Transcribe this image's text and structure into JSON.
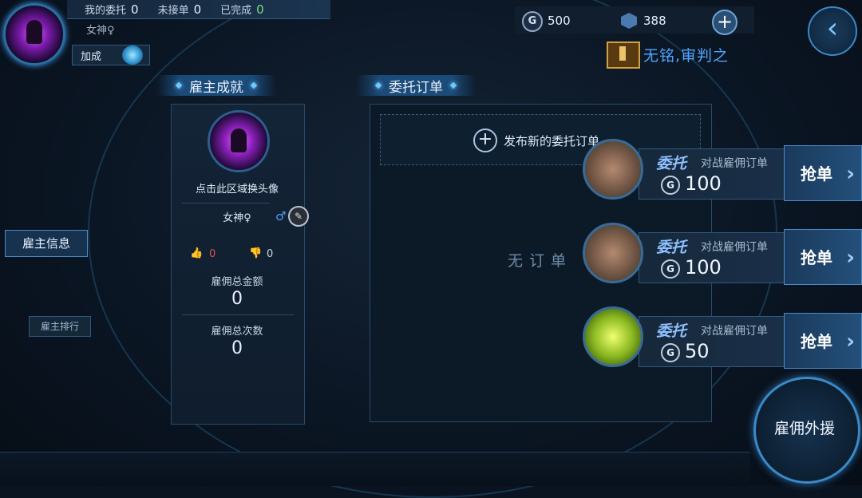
{
  "header": {
    "my_commission_label": "我的委托",
    "my_commission_count": "0",
    "unaccepted_label": "未接单",
    "unaccepted_count": "0",
    "completed_label": "已完成",
    "completed_count": "0",
    "player_name": "女神♀",
    "bonus_label": "加成"
  },
  "currency": {
    "coins": "500",
    "gems": "388",
    "coin_icon": "G"
  },
  "title_banner": "无铭,审判之",
  "sections": {
    "employer_achievement": "雇主成就",
    "commission_orders": "委托订单"
  },
  "employer_card": {
    "change_avatar": "点击此区域换头像",
    "name": "女神♀",
    "likes": "0",
    "dislikes": "0",
    "total_amount_label": "雇佣总金额",
    "total_amount": "0",
    "total_count_label": "雇佣总次数",
    "total_count": "0"
  },
  "orders_panel": {
    "publish_new": "发布新的委托订单",
    "empty": "无订单"
  },
  "left_nav": {
    "employer_info": "雇主信息",
    "employer_rank": "雇主排行"
  },
  "order_list": [
    {
      "type": "委托",
      "desc": "对战雇佣订单",
      "price": "100",
      "grab": "抢单",
      "avatar_color": "#6a5040"
    },
    {
      "type": "委托",
      "desc": "对战雇佣订单",
      "price": "100",
      "grab": "抢单",
      "avatar_color": "#6a5040"
    },
    {
      "type": "委托",
      "desc": "对战雇佣订单",
      "price": "50",
      "grab": "抢单",
      "avatar_color": "#8ab820"
    }
  ],
  "support_button": "雇佣外援",
  "colors": {
    "accent": "#4aa0ff",
    "title_blue": "#4fa6ff",
    "completed_green": "#7fdc7f",
    "like_red": "#e0504a"
  }
}
